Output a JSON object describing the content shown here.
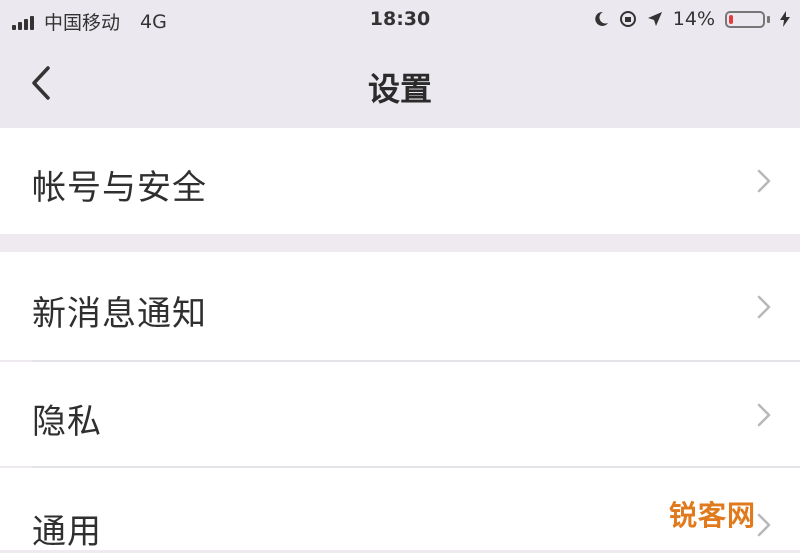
{
  "status_bar": {
    "carrier": "中国移动",
    "network": "4G",
    "time": "18:30",
    "battery_text": "14%",
    "battery_level": 0.14,
    "battery_color": "#e53b3b"
  },
  "nav": {
    "back_icon": "chevron-left-icon",
    "title": "设置"
  },
  "settings": {
    "items": [
      {
        "label": "帐号与安全"
      },
      {
        "label": "新消息通知"
      },
      {
        "label": "隐私"
      },
      {
        "label": "通用"
      }
    ]
  },
  "watermark": {
    "text": "锐客网"
  }
}
